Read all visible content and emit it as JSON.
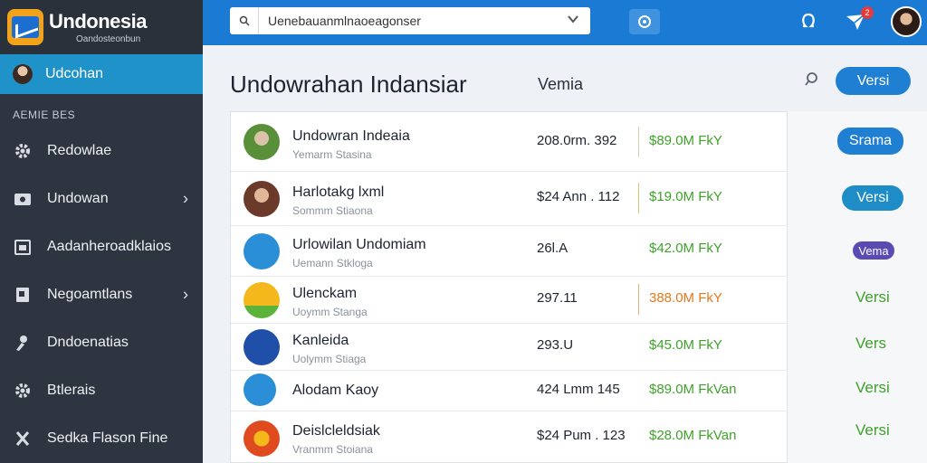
{
  "brand": {
    "title": "Undonesia",
    "subtitle": "Oandosteonbun"
  },
  "sidebar": {
    "active_item": "Udcohan",
    "section_label": "AEMIE BES",
    "items": [
      {
        "label": "Redowlae",
        "icon": "gear-icon",
        "chevron": false
      },
      {
        "label": "Undowan",
        "icon": "folder-icon",
        "chevron": true
      },
      {
        "label": "Aadanheroadklaios",
        "icon": "document-icon",
        "chevron": false
      },
      {
        "label": "Negoamtlans",
        "icon": "file-icon",
        "chevron": true
      },
      {
        "label": "Dndoenatias",
        "icon": "user-icon",
        "chevron": false
      },
      {
        "label": "Btlerais",
        "icon": "gear-icon",
        "chevron": false
      },
      {
        "label": "Sedka Flason Fine",
        "icon": "close-icon",
        "chevron": false
      }
    ]
  },
  "topbar": {
    "search_value": "Uenebauanmlnaoeagonser",
    "badge_count": "2"
  },
  "main": {
    "title": "Undowrahan Indansiar",
    "subtitle": "Vemia",
    "header_button": "Versi"
  },
  "rows": [
    {
      "name": "Undowran Indeaia",
      "sub": "Yemarm Stasina",
      "volume": "208.0rm. 392",
      "price": "$89.0M  FkY",
      "price_color": "#3fa12b",
      "logo": "#5a8f3a",
      "action": "Srama",
      "action_style": "button",
      "action_color": "#1f7fd2"
    },
    {
      "name": "Harlotakg lxml",
      "sub": "Sommm Stiaona",
      "volume": "$24 Ann . 112",
      "price": "$19.0M  FkY",
      "price_color": "#3fa12b",
      "logo": "#6b3a2a",
      "action": "Versi",
      "action_style": "button",
      "action_color": "#1d8cc7"
    },
    {
      "name": "Urlowilan Undomiam",
      "sub": "Uemann Stkloga",
      "volume": "26l.A",
      "price": "$42.0M  FkY",
      "price_color": "#3fa12b",
      "logo": "#2a8fd6",
      "action": "Vema",
      "action_style": "pill",
      "action_color": "#5a4bb3"
    },
    {
      "name": "Ulenckam",
      "sub": "Uoymm Stanga",
      "volume": "297.11",
      "price": "388.0M  FkY",
      "price_color": "#e07a1f",
      "logo": "#f4b81c",
      "action": "Versi",
      "action_style": "text",
      "action_color": "#3fa12b"
    },
    {
      "name": "Kanleida",
      "sub": "Uolymm Stiaga",
      "volume": "293.U",
      "price": "$45.0M  FkY",
      "price_color": "#3fa12b",
      "logo": "#1f4fa8",
      "action": "Vers",
      "action_style": "text",
      "action_color": "#3fa12b"
    },
    {
      "name": "Alodam Kaoy",
      "sub": "",
      "volume": "424 Lmm  145",
      "price": "$89.0M  FkVan",
      "price_color": "#3fa12b",
      "logo": "#2a8fd6",
      "action": "Versi",
      "action_style": "text",
      "action_color": "#3fa12b"
    },
    {
      "name": "Deislcleldsiak",
      "sub": "Vranmm Stoiana",
      "volume": "$24 Pum . 123",
      "price": "$28.0M  FkVan",
      "price_color": "#3fa12b",
      "logo": "#e04a1f",
      "action": "Versi",
      "action_style": "text",
      "action_color": "#3fa12b"
    }
  ]
}
